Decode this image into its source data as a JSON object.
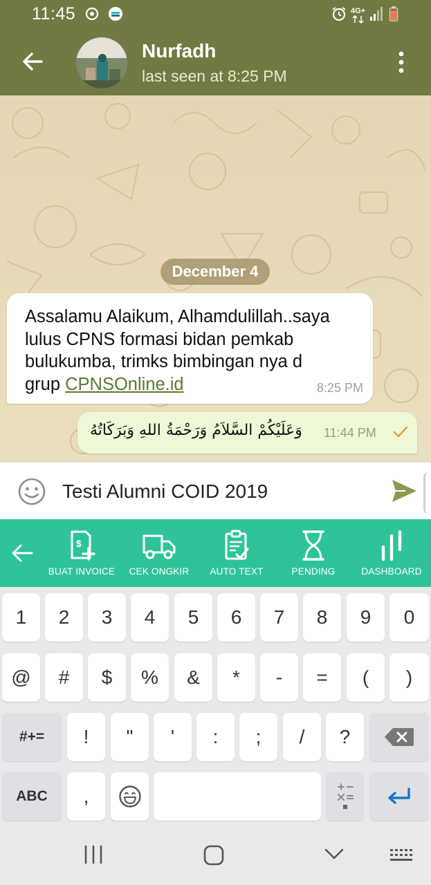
{
  "status_bar": {
    "time": "11:45",
    "network": "4G+",
    "icons": [
      "sync-icon",
      "messenger-app-icon",
      "alarm-icon",
      "signal-icon",
      "battery-icon"
    ]
  },
  "header": {
    "contact_name": "Nurfadh",
    "last_seen": "last seen at 8:25 PM",
    "icons": [
      "back-arrow-icon",
      "avatar",
      "more-vert-icon"
    ]
  },
  "chat": {
    "date_label": "December 4",
    "incoming": {
      "lines": [
        "Assalamu Alaikum, Alhamdulillah..saya",
        "lulus CPNS formasi bidan pemkab",
        "bulukumba, trimks bimbingan nya d"
      ],
      "last_line_prefix": "grup ",
      "link": "CPNSOnline.id",
      "time": "8:25 PM"
    },
    "outgoing": {
      "text": "وَعَلَيْكُمْ السَّلاَمُ وَرَحْمَةُ اللهِ وَبَرَكَاتُهُ",
      "time": "11:44 PM",
      "status_icon": "single-check-icon"
    }
  },
  "composer": {
    "value": "Testi Alumni COID 2019",
    "icons": [
      "emoji-icon",
      "send-icon"
    ]
  },
  "toolbar": {
    "back_icon": "back-arrow-icon",
    "items": [
      {
        "label": "BUAT INVOICE",
        "icon": "invoice-add-icon"
      },
      {
        "label": "CEK ONGKIR",
        "icon": "truck-icon"
      },
      {
        "label": "AUTO TEXT",
        "icon": "clipboard-check-icon"
      },
      {
        "label": "PENDING",
        "icon": "hourglass-icon"
      },
      {
        "label": "DASHBOARD",
        "icon": "bar-chart-icon"
      }
    ],
    "accent": "#2fc39a"
  },
  "keyboard": {
    "row1": [
      "1",
      "2",
      "3",
      "4",
      "5",
      "6",
      "7",
      "8",
      "9",
      "0"
    ],
    "row2": [
      "@",
      "#",
      "$",
      "%",
      "&",
      "*",
      "-",
      "=",
      "(",
      ")"
    ],
    "row3": [
      "#+=",
      "!",
      "\"",
      "'",
      ":",
      ";",
      "/",
      "?"
    ],
    "row4": {
      "abc": "ABC",
      "comma": ","
    },
    "icons": [
      "backspace-icon",
      "emoji-icon",
      "math-symbols-icon",
      "enter-icon"
    ]
  },
  "nav_bar": {
    "icons": [
      "recents-icon",
      "home-icon",
      "hide-keyboard-icon",
      "keyboard-icon"
    ]
  },
  "colors": {
    "header": "#717a42",
    "chat_bg": "#e8dcbb",
    "outgoing_bubble": "#eef8d6",
    "link": "#5a7a2e"
  }
}
